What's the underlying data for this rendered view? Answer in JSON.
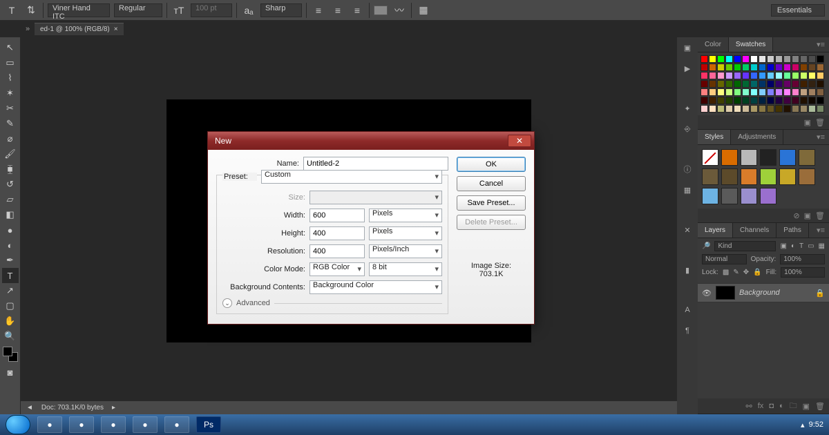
{
  "workspace": "Essentials",
  "options": {
    "font_family": "Viner Hand ITC",
    "font_style": "Regular",
    "font_size": "100 pt",
    "antialiasing": "Sharp"
  },
  "document": {
    "tab_title": "ed-1 @ 100% (RGB/8)",
    "status_doc": "Doc: 703.1K/0 bytes"
  },
  "dialog": {
    "title": "New",
    "name_label": "Name:",
    "name_value": "Untitled-2",
    "preset_label": "Preset:",
    "preset_value": "Custom",
    "size_label": "Size:",
    "width_label": "Width:",
    "width_value": "600",
    "width_unit": "Pixels",
    "height_label": "Height:",
    "height_value": "400",
    "height_unit": "Pixels",
    "resolution_label": "Resolution:",
    "resolution_value": "400",
    "resolution_unit": "Pixels/Inch",
    "color_mode_label": "Color Mode:",
    "color_mode_value": "RGB Color",
    "color_depth": "8 bit",
    "bg_contents_label": "Background Contents:",
    "bg_contents_value": "Background Color",
    "advanced_label": "Advanced",
    "image_size_label": "Image Size:",
    "image_size_value": "703.1K",
    "ok": "OK",
    "cancel": "Cancel",
    "save_preset": "Save Preset...",
    "delete_preset": "Delete Preset..."
  },
  "panels": {
    "color_tab": "Color",
    "swatches_tab": "Swatches",
    "styles_tab": "Styles",
    "adjustments_tab": "Adjustments",
    "layers_tab": "Layers",
    "channels_tab": "Channels",
    "paths_tab": "Paths",
    "layer_kind": "Kind",
    "blend_mode": "Normal",
    "opacity_label": "Opacity:",
    "opacity_value": "100%",
    "lock_label": "Lock:",
    "fill_label": "Fill:",
    "fill_value": "100%",
    "bg_layer_name": "Background"
  },
  "swatch_colors": [
    "#ff0000",
    "#ffff00",
    "#00ff00",
    "#00ffff",
    "#0000ff",
    "#ff00ff",
    "#ffffff",
    "#e6e6e6",
    "#cccccc",
    "#b3b3b3",
    "#999999",
    "#808080",
    "#666666",
    "#4d4d4d",
    "#000000",
    "#c00000",
    "#cc6600",
    "#cccc00",
    "#66cc00",
    "#00cc00",
    "#00cc66",
    "#00cccc",
    "#0066cc",
    "#0000cc",
    "#6600cc",
    "#cc00cc",
    "#cc0066",
    "#804000",
    "#664422",
    "#996633",
    "#ff3366",
    "#ff6699",
    "#ff99cc",
    "#cc99ff",
    "#9966ff",
    "#6633ff",
    "#3366ff",
    "#3399ff",
    "#66ccff",
    "#99ffff",
    "#66ff99",
    "#99ff66",
    "#ccff66",
    "#ffff66",
    "#ffcc66",
    "#660000",
    "#663300",
    "#666600",
    "#336600",
    "#006600",
    "#006633",
    "#006666",
    "#003366",
    "#000066",
    "#330066",
    "#660066",
    "#660033",
    "#402000",
    "#332211",
    "#221100",
    "#ff8080",
    "#ffcc80",
    "#ffff80",
    "#ccff80",
    "#80ff80",
    "#80ffcc",
    "#80ffff",
    "#80ccff",
    "#8080ff",
    "#cc80ff",
    "#ff80ff",
    "#ff80cc",
    "#bfa080",
    "#a08060",
    "#806040",
    "#400000",
    "#402000",
    "#404000",
    "#204000",
    "#004000",
    "#004020",
    "#004040",
    "#002040",
    "#000040",
    "#200040",
    "#400040",
    "#400020",
    "#201000",
    "#100800",
    "#000000",
    "#ffd0d0",
    "#ffe0c0",
    "#bbbb77",
    "#ddccaa",
    "#eeddbb",
    "#ccbb99",
    "#aa9966",
    "#887744",
    "#665522",
    "#443300",
    "#221100",
    "#887755",
    "#998866",
    "#aabb99",
    "#778866"
  ],
  "style_colors": [
    "none",
    "#d96c00",
    "#b8b8b8",
    "#222",
    "#2a74d6",
    "#7f6a3a",
    "#6b5a3a",
    "#5c4a2a",
    "#d97c2a",
    "#9fd13a",
    "#c8a827",
    "#9a6d3a",
    "#6db3e3",
    "#5a5a5a",
    "#9a8fce",
    "#9a6fce"
  ],
  "taskbar": {
    "time": "9:52"
  }
}
